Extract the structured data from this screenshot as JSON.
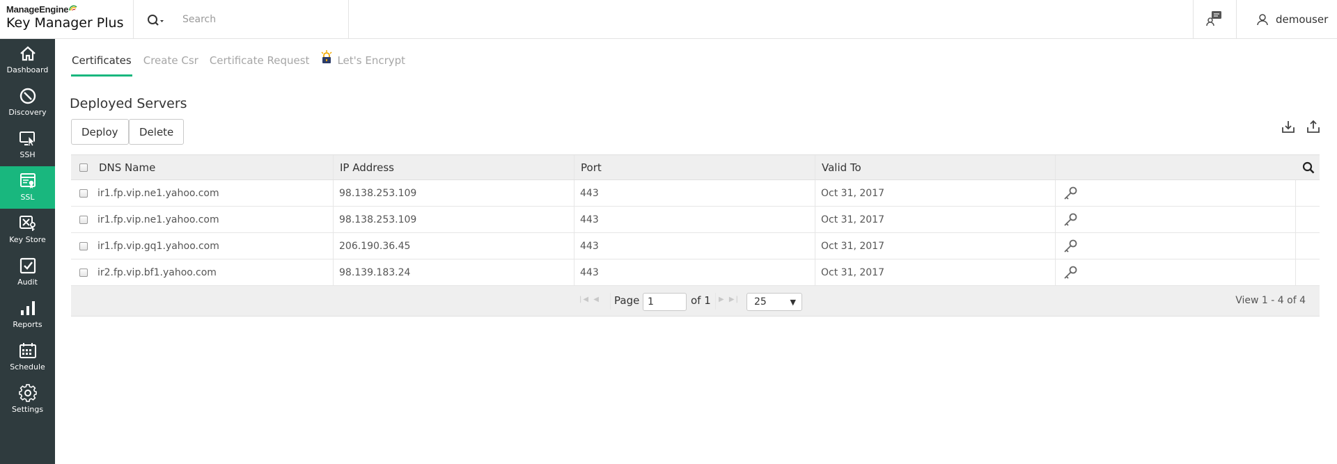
{
  "header": {
    "vendor": "ManageEngine",
    "product": "Key Manager Plus",
    "search_placeholder": "Search",
    "user": "demouser"
  },
  "sidebar": {
    "items": [
      {
        "label": "Dashboard",
        "icon": "home-icon"
      },
      {
        "label": "Discovery",
        "icon": "compass-icon"
      },
      {
        "label": "SSH",
        "icon": "ssh-monitor-icon"
      },
      {
        "label": "SSL",
        "icon": "ssl-certificate-icon",
        "active": true
      },
      {
        "label": "Key Store",
        "icon": "key-store-icon"
      },
      {
        "label": "Audit",
        "icon": "audit-check-icon"
      },
      {
        "label": "Reports",
        "icon": "bar-chart-icon"
      },
      {
        "label": "Schedule",
        "icon": "calendar-icon"
      },
      {
        "label": "Settings",
        "icon": "gear-icon"
      }
    ],
    "active_color": "#19b77e",
    "bg_color": "#2f3b3e"
  },
  "tabs": [
    {
      "label": "Certificates",
      "active": true
    },
    {
      "label": "Create Csr"
    },
    {
      "label": "Certificate Request"
    },
    {
      "label": "Let's Encrypt"
    }
  ],
  "section": {
    "title": "Deployed Servers",
    "deploy_label": "Deploy",
    "delete_label": "Delete"
  },
  "table": {
    "columns": [
      "DNS Name",
      "IP Address",
      "Port",
      "Valid To"
    ],
    "rows": [
      {
        "dns": "ir1.fp.vip.ne1.yahoo.com",
        "ip": "98.138.253.109",
        "port": "443",
        "valid_to": "Oct 31, 2017"
      },
      {
        "dns": "ir1.fp.vip.ne1.yahoo.com",
        "ip": "98.138.253.109",
        "port": "443",
        "valid_to": "Oct 31, 2017"
      },
      {
        "dns": "ir1.fp.vip.gq1.yahoo.com",
        "ip": "206.190.36.45",
        "port": "443",
        "valid_to": "Oct 31, 2017"
      },
      {
        "dns": "ir2.fp.vip.bf1.yahoo.com",
        "ip": "98.139.183.24",
        "port": "443",
        "valid_to": "Oct 31, 2017"
      }
    ]
  },
  "pager": {
    "page_label": "Page",
    "page_value": "1",
    "of_label": "of 1",
    "page_size": "25",
    "view_text": "View 1 - 4 of 4"
  }
}
